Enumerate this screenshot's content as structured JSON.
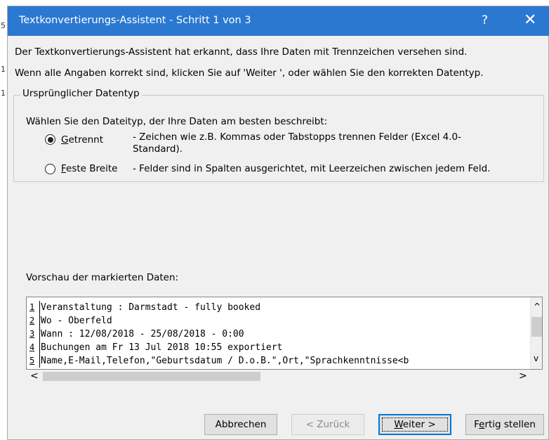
{
  "dialog": {
    "title": "Textkonvertierungs-Assistent - Schritt 1 von 3",
    "help_icon": "?",
    "close_icon": "✕",
    "intro_line1": "Der Textkonvertierungs-Assistent hat erkannt, dass Ihre Daten mit Trennzeichen versehen sind.",
    "intro_line2": "Wenn alle Angaben korrekt sind, klicken Sie auf 'Weiter ', oder wählen Sie den korrekten Datentyp."
  },
  "datatype_group": {
    "legend": "Ursprünglicher Datentyp",
    "prompt": "Wählen Sie den Dateityp, der Ihre Daten am besten beschreibt:",
    "options": [
      {
        "label_accel": "G",
        "label_rest": "etrennt",
        "selected": true,
        "description": "- Zeichen wie z.B. Kommas oder Tabstopps trennen Felder (Excel 4.0-Standard)."
      },
      {
        "label_accel": "F",
        "label_rest": "este Breite",
        "selected": false,
        "description": "- Felder sind in Spalten ausgerichtet, mit Leerzeichen zwischen jedem Feld."
      }
    ]
  },
  "preview": {
    "label": "Vorschau der markierten Daten:",
    "rows": [
      {
        "num": "1",
        "text": "Veranstaltung : Darmstadt - fully booked"
      },
      {
        "num": "2",
        "text": "Wo - Oberfeld"
      },
      {
        "num": "3",
        "text": "Wann : 12/08/2018 - 25/08/2018 - 0:00"
      },
      {
        "num": "4",
        "text": "Buchungen am Fr 13 Jul 2018 10:55 exportiert"
      },
      {
        "num": "5",
        "text": "Name,E-Mail,Telefon,\"Geburtsdatum / D.o.B.\",Ort,\"Sprachkenntnisse<b"
      }
    ],
    "scroll_up": "^",
    "scroll_down": "v",
    "scroll_left": "<",
    "scroll_right": ">"
  },
  "buttons": {
    "cancel": "Abbrechen",
    "back": "< Zurück",
    "next_accel": "W",
    "next_rest": "eiter >",
    "finish_pre": "F",
    "finish_accel": "e",
    "finish_rest": "rtig stellen"
  },
  "background": {
    "row_numbers": [
      "5",
      "1",
      "1"
    ]
  }
}
